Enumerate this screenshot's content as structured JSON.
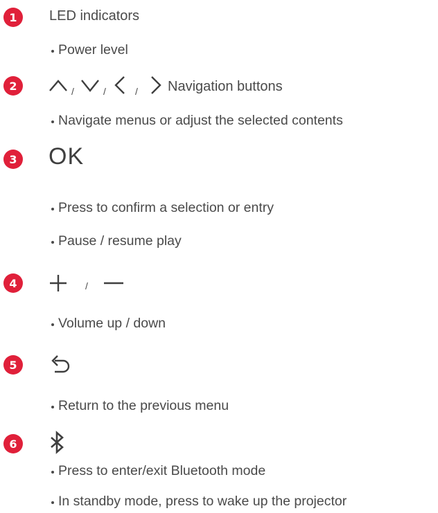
{
  "colors": {
    "accent": "#e0203a",
    "text": "#4a4a4a"
  },
  "sections": [
    {
      "number": "1",
      "title": "LED indicators",
      "bullets": [
        "Power level"
      ]
    },
    {
      "number": "2",
      "icons": [
        "up-chevron-icon",
        "down-chevron-icon",
        "left-chevron-icon",
        "right-chevron-icon"
      ],
      "separator": "/",
      "title": "Navigation buttons",
      "bullets": [
        "Navigate menus or adjust the selected contents"
      ]
    },
    {
      "number": "3",
      "title": "OK",
      "bullets": [
        "Press to confirm a selection or entry",
        "Pause / resume play"
      ]
    },
    {
      "number": "4",
      "icons": [
        "plus-icon",
        "minus-icon"
      ],
      "separator": "/",
      "bullets": [
        "Volume up / down"
      ]
    },
    {
      "number": "5",
      "icons": [
        "return-icon"
      ],
      "bullets": [
        "Return to the previous menu"
      ]
    },
    {
      "number": "6",
      "icons": [
        "bluetooth-icon"
      ],
      "bullets": [
        "Press to enter/exit Bluetooth mode",
        "In standby mode, press to wake up the projector"
      ]
    }
  ]
}
